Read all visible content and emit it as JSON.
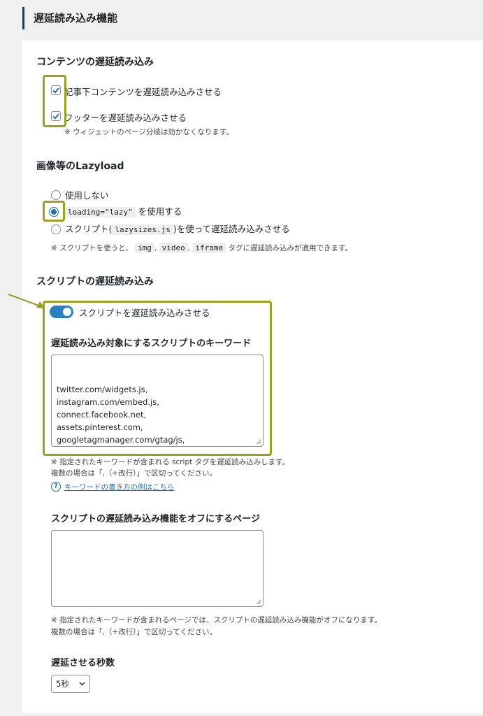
{
  "header": {
    "title": "遅延読み込み機能"
  },
  "content_lazy": {
    "heading": "コンテンツの遅延読み込み",
    "opt1_label": "記事下コンテンツを遅延読み込みさせる",
    "opt1_checked": true,
    "opt2_label": "フッターを遅延読み込みさせる",
    "opt2_checked": true,
    "note": "※ ウィジェットのページ分岐は効かなくなります。"
  },
  "lazyload": {
    "heading": "画像等のLazyload",
    "radio1_label": "使用しない",
    "radio2_code": "loading=\"lazy\"",
    "radio2_suffix": "を使用する",
    "radio3_prefix": "スクリプト(",
    "radio3_code": "lazysizes.js",
    "radio3_suffix": ")を使って遅延読み込みさせる",
    "selected": 2,
    "note_prefix": "※ スクリプトを使うと、",
    "note_code1": "img",
    "note_sep1": ",",
    "note_code2": "video",
    "note_sep2": ",",
    "note_code3": "iframe",
    "note_suffix": "タグに遅延読み込みが適用できます。"
  },
  "script_lazy": {
    "heading": "スクリプトの遅延読み込み",
    "toggle_label": "スクリプトを遅延読み込みさせる",
    "toggle_on": true,
    "keywords_heading": "遅延読み込み対象にするスクリプトのキーワード",
    "keywords_value": "twitter.com/widgets.js,\ninstagram.com/embed.js,\nconnect.facebook.net,\nassets.pinterest.com,\ngoogletagmanager.com/gtag/js,\nadsbygoogle.js,\nclipboard.min.js",
    "keywords_note1": "※ 指定されたキーワードが含まれる script タグを遅延読み込みします。",
    "keywords_note2": "複数の場合は「,（+改行）」で区切ってください。",
    "help_icon_glyph": "?",
    "help_link": "キーワードの書き方の例はこちら",
    "off_pages_heading": "スクリプトの遅延読み込み機能をオフにするページ",
    "off_pages_value": "",
    "off_pages_note1": "※ 指定されたキーワードが含まれるページでは、スクリプトの遅延読み込み機能がオフになります。",
    "off_pages_note2": "複数の場合は「,（+改行）」で区切ってください。",
    "delay_heading": "遅延させる秒数",
    "delay_value": "5秒"
  },
  "colors": {
    "highlight": "#9aa01f",
    "accent": "#2271b1",
    "toggle": "#2b7fc3"
  }
}
